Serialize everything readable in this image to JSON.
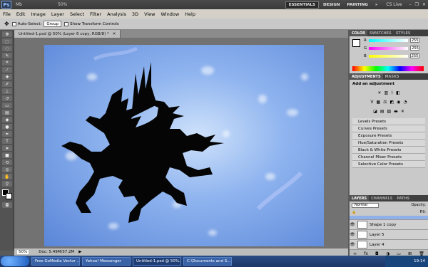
{
  "app": {
    "logo": "Ps",
    "zoom": "50%",
    "mini_label": "Mb"
  },
  "workspaces": [
    "ESSENTIALS",
    "DESIGN",
    "PAINTING",
    "»"
  ],
  "cslive": "CS Live",
  "menu": [
    "File",
    "Edit",
    "Image",
    "Layer",
    "Select",
    "Filter",
    "Analysis",
    "3D",
    "View",
    "Window",
    "Help"
  ],
  "options": {
    "auto_select_label": "Auto-Select:",
    "auto_select_value": "Group",
    "transform_label": "Show Transform Controls"
  },
  "document": {
    "tab_title": "Untitled-1.psd @ 50% (Layer 6 copy, RGB/8) *",
    "status_zoom": "50%",
    "status_doc": "Doc: 5.49M/37.2M"
  },
  "color_panel": {
    "tabs": [
      "COLOR",
      "SWATCHES",
      "STYLES"
    ],
    "r": "255",
    "g": "255",
    "b": "255"
  },
  "adjustments": {
    "tabs": [
      "ADJUSTMENTS",
      "MASKS"
    ],
    "heading": "Add an adjustment",
    "presets": [
      "Levels Presets",
      "Curves Presets",
      "Exposure Presets",
      "Hue/Saturation Presets",
      "Black & White Presets",
      "Channel Mixer Presets",
      "Selective Color Presets"
    ]
  },
  "layers": {
    "tabs": [
      "LAYERS",
      "CHANNELS",
      "PATHS"
    ],
    "blend": "Normal",
    "opacity_label": "Opacity:",
    "fill_label": "Fill:",
    "items": [
      "Shape 1 copy",
      "Layer 5",
      "Layer 4"
    ]
  },
  "taskbar": {
    "items": [
      "Free GoMedia Vector ...",
      "Yahoo! Messenger",
      "Untitled-1.psd @ 50%...",
      "C:\\Documents and S..."
    ],
    "clock": "19:14"
  },
  "colors": {
    "canvas_blue": "#7aa3e8",
    "dragon": "#050505"
  }
}
